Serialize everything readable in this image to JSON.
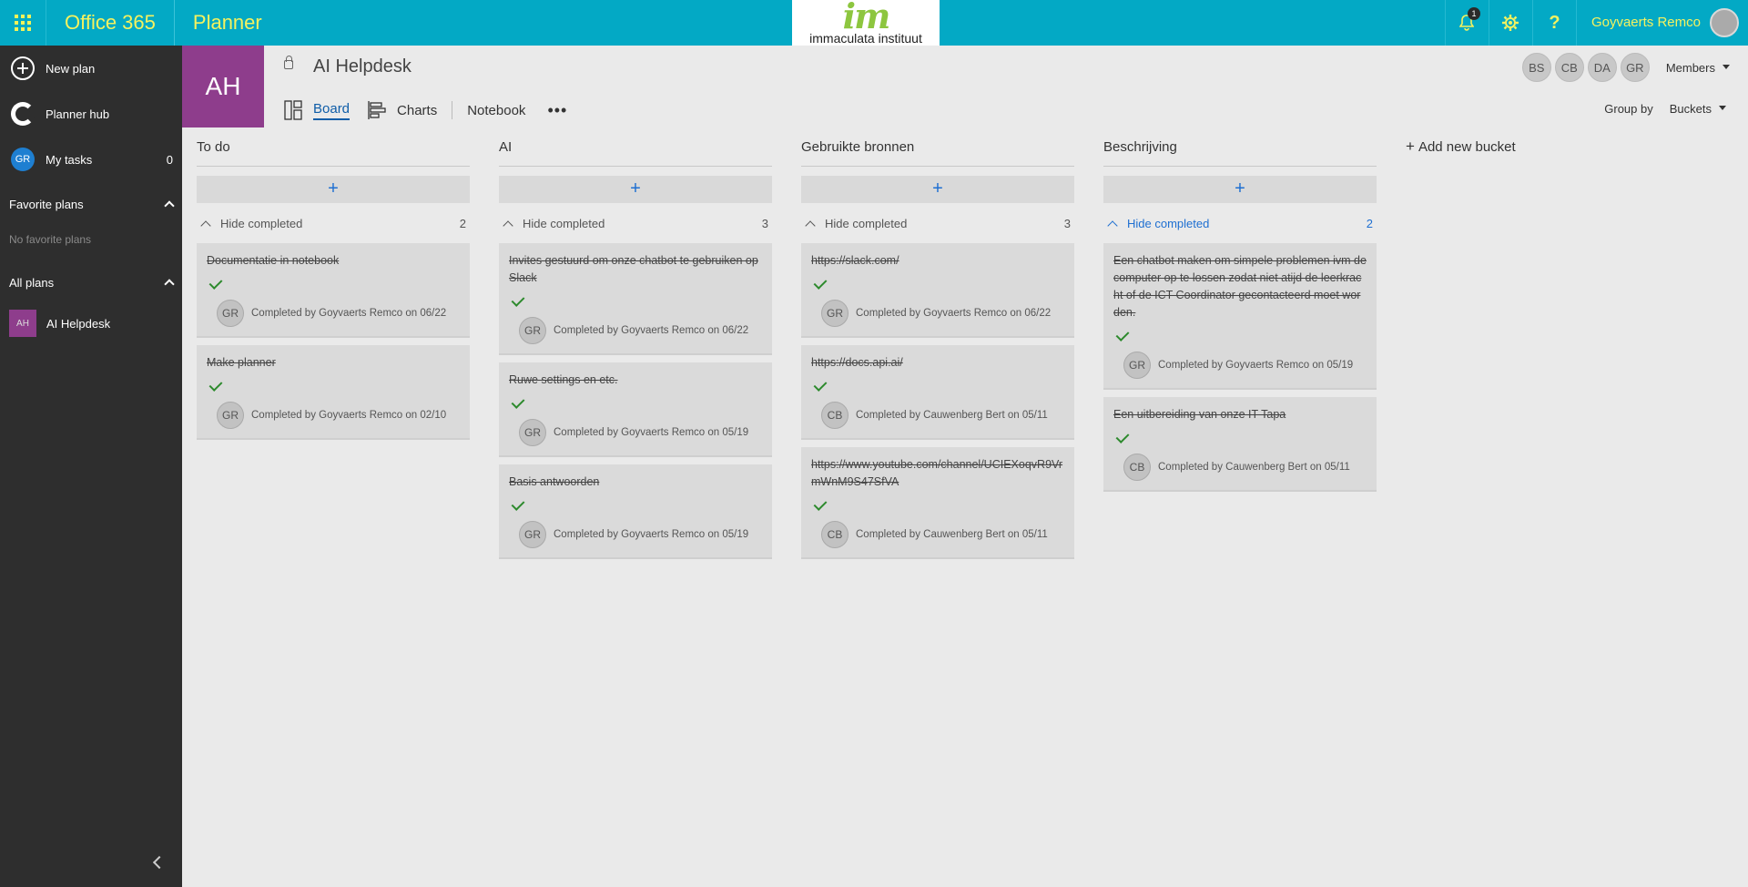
{
  "topbar": {
    "suite": "Office 365",
    "app": "Planner",
    "logo_text": "immaculata instituut",
    "logo_mark": "im",
    "notification_count": "1",
    "username": "Goyvaerts Remco"
  },
  "sidebar": {
    "new_plan": "New plan",
    "hub": "Planner hub",
    "my_tasks": "My tasks",
    "my_tasks_avatar": "GR",
    "my_tasks_count": "0",
    "favorites_header": "Favorite plans",
    "favorites_empty": "No favorite plans",
    "all_plans_header": "All plans",
    "plans": [
      {
        "initials": "AH",
        "name": "AI Helpdesk"
      }
    ]
  },
  "header": {
    "plan_initials": "AH",
    "plan_title": "AI Helpdesk",
    "tabs": [
      "Board",
      "Charts",
      "Notebook"
    ],
    "more": "•••",
    "members": [
      "BS",
      "CB",
      "DA",
      "GR"
    ],
    "members_label": "Members",
    "group_by_label": "Group by",
    "group_by_value": "Buckets"
  },
  "board": {
    "add_symbol": "+",
    "hide_completed": "Hide completed",
    "add_new_bucket": "Add new bucket",
    "buckets": [
      {
        "name": "To do",
        "completed_count": "2",
        "tasks": [
          {
            "title": "Documentatie in notebook",
            "avatar": "GR",
            "completed": "Completed by Goyvaerts Remco on 06/22"
          },
          {
            "title": "Make planner",
            "avatar": "GR",
            "completed": "Completed by Goyvaerts Remco on 02/10"
          }
        ]
      },
      {
        "name": "AI",
        "completed_count": "3",
        "tasks": [
          {
            "title": "Invites gestuurd om onze chatbot te gebruiken op Slack",
            "avatar": "GR",
            "completed": "Completed by Goyvaerts Remco on 06/22"
          },
          {
            "title": "Ruwe settings en etc.",
            "avatar": "GR",
            "completed": "Completed by Goyvaerts Remco on 05/19"
          },
          {
            "title": "Basis antwoorden",
            "avatar": "GR",
            "completed": "Completed by Goyvaerts Remco on 05/19"
          }
        ]
      },
      {
        "name": "Gebruikte bronnen",
        "completed_count": "3",
        "tasks": [
          {
            "title": "https://slack.com/",
            "avatar": "GR",
            "completed": "Completed by Goyvaerts Remco on 06/22"
          },
          {
            "title": "https://docs.api.ai/",
            "avatar": "CB",
            "completed": "Completed by Cauwenberg Bert on 05/11"
          },
          {
            "title": "https://www.youtube.com/channel/UCIEXoqvR9VrmWnM9S47SfVA",
            "avatar": "CB",
            "completed": "Completed by Cauwenberg Bert on 05/11"
          }
        ]
      },
      {
        "name": "Beschrijving",
        "completed_count": "2",
        "tasks": [
          {
            "title": "Een chatbot maken om simpele problemen ivm de computer op te lossen zodat niet atijd de leerkracht of de ICT Coordinator gecontacteerd moet worden.",
            "avatar": "GR",
            "completed": "Completed by Goyvaerts Remco on 05/19"
          },
          {
            "title": "Een uitbereiding van onze IT Tapa",
            "avatar": "CB",
            "completed": "Completed by Cauwenberg Bert on 05/11"
          }
        ]
      }
    ]
  }
}
